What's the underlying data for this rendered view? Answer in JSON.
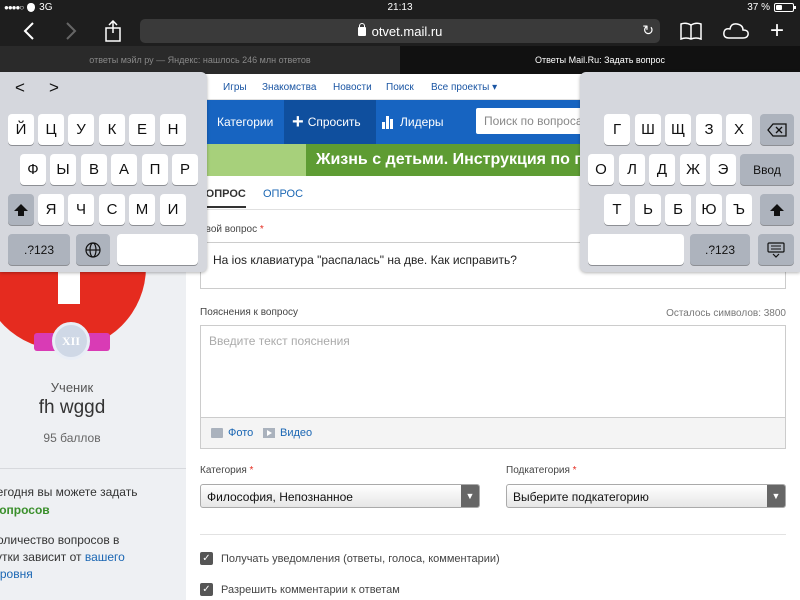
{
  "status_bar": {
    "carrier_dots": "●●●●○",
    "network": "3G",
    "time": "21:13",
    "battery": "37 %",
    "battery_level": 0.37
  },
  "safari": {
    "url": "otvet.mail.ru",
    "icons": [
      "back-arrow-icon",
      "forward-arrow-icon",
      "share-icon",
      "lock-icon",
      "reload-icon",
      "bookmarks-icon",
      "cloud-icon",
      "new-tab-icon"
    ],
    "tabs": [
      {
        "title": "ответы мэйл ру — Яндекс: нашлось 246 млн ответов",
        "active": false
      },
      {
        "title": "Ответы Mail.Ru: Задать вопрос",
        "active": true
      }
    ]
  },
  "site_nav": {
    "items": [
      "Игры",
      "Знакомства",
      "Новости",
      "Поиск",
      "Все проекты ▾"
    ]
  },
  "main_nav": {
    "categories": "Категории",
    "ask": "Спросить",
    "leaders": "Лидеры",
    "search_placeholder": "Поиск по вопросам"
  },
  "banner": {
    "text": "Жизнь с детьми. Инструкция по применению"
  },
  "form": {
    "tabs": [
      "ВОПРОС",
      "ОПРОС"
    ],
    "question_label": "Твой вопрос",
    "question_value": "На ios клавиатура \"распалась\" на две. Как исправить?",
    "explanation_label": "Пояснения к вопросу",
    "chars_left": "Осталось символов: 3800",
    "explanation_placeholder": "Введите текст пояснения",
    "photo": "Фото",
    "video": "Видео",
    "category_label": "Категория",
    "category_value": "Философия, Непознанное",
    "subcategory_label": "Подкатегория",
    "subcategory_value": "Выберите подкатегорию",
    "notify_label": "Получать уведомления (ответы, голоса, комментарии)",
    "comments_label": "Разрешить комментарии к ответам"
  },
  "profile": {
    "medal": "XII",
    "rank": "Ученик",
    "username": "fh wggd",
    "points": "95 баллов",
    "info_1": "Сегодня вы можете задать",
    "info_2": "вопросов",
    "info_3": "Количество вопросов в",
    "info_4": "сутки зависит от",
    "info_link": "вашего",
    "info_5": "уровня"
  },
  "keyboard_left": {
    "nav": [
      "<",
      ">"
    ],
    "row1": [
      "Й",
      "Ц",
      "У",
      "К",
      "Е",
      "Н"
    ],
    "row2": [
      "Ф",
      "Ы",
      "В",
      "А",
      "П",
      "Р"
    ],
    "row3": [
      "Я",
      "Ч",
      "С",
      "М",
      "И"
    ],
    "numbers_key": ".?123"
  },
  "keyboard_right": {
    "row1": [
      "Г",
      "Ш",
      "Щ",
      "З",
      "Х"
    ],
    "row2": [
      "О",
      "Л",
      "Д",
      "Ж",
      "Э"
    ],
    "row3": [
      "Т",
      "Ь",
      "Б",
      "Ю",
      "Ъ"
    ],
    "return_key": "Ввод",
    "numbers_key": ".?123"
  }
}
